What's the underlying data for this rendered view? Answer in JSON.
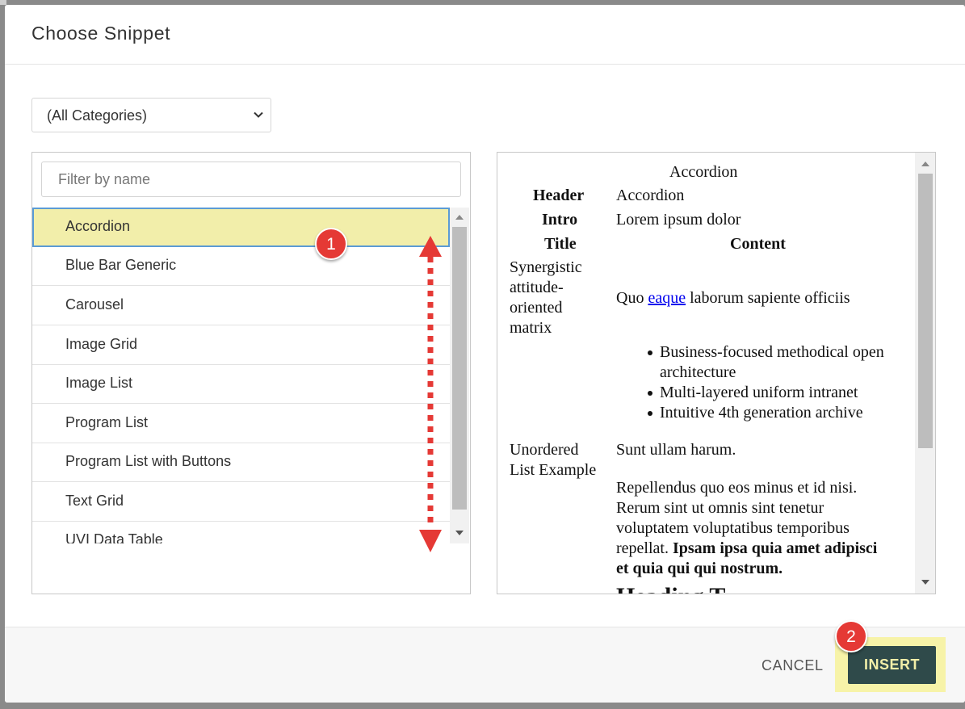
{
  "dialog": {
    "title": "Choose Snippet"
  },
  "category_select": {
    "value": "(All Categories)"
  },
  "filter": {
    "placeholder": "Filter by name"
  },
  "snippets": [
    {
      "label": "Accordion",
      "selected": true
    },
    {
      "label": "Blue Bar Generic"
    },
    {
      "label": "Carousel"
    },
    {
      "label": "Image Grid"
    },
    {
      "label": "Image List"
    },
    {
      "label": "Program List"
    },
    {
      "label": "Program List with Buttons"
    },
    {
      "label": "Text Grid"
    },
    {
      "label": "UVI Data Table"
    }
  ],
  "preview": {
    "caption": "Accordion",
    "header_label": "Header",
    "header_value": "Accordion",
    "intro_label": "Intro",
    "intro_value": "Lorem ipsum dolor",
    "col_title": "Title",
    "col_content": "Content",
    "row1_title": [
      "Synergistic",
      "attitude-",
      "oriented",
      "matrix"
    ],
    "row1_text_before": "Quo ",
    "row1_link": "eaque",
    "row1_text_after": " laborum sapiente officiis",
    "row1_bullets": [
      "Business-focused methodical open",
      "architecture",
      "Multi-layered uniform intranet",
      "Intuitive 4th generation archive"
    ],
    "row2_title": [
      "Unordered",
      "List Example"
    ],
    "row2_p1": "Sunt ullam harum.",
    "row2_p2": [
      "Repellendus quo eos minus et id nisi.",
      "Rerum sint ut omnis sint tenetur",
      "voluptatem voluptatibus temporibus",
      "repellat. "
    ],
    "row2_bold": [
      "Ipsam ipsa quia amet adipisci",
      "et quia qui qui nostrum."
    ],
    "heading_partial": "Heading T"
  },
  "footer": {
    "cancel_label": "CANCEL",
    "insert_label": "INSERT"
  },
  "annotations": [
    {
      "number": "1"
    },
    {
      "number": "2"
    }
  ],
  "colors": {
    "selected_item_bg": "#f2eeaa",
    "selected_item_border": "#5b9bd5",
    "insert_button": "#2f4a4a",
    "insert_text": "#f2eea8",
    "highlight": "#f7f3a8",
    "badge": "#e53935"
  }
}
